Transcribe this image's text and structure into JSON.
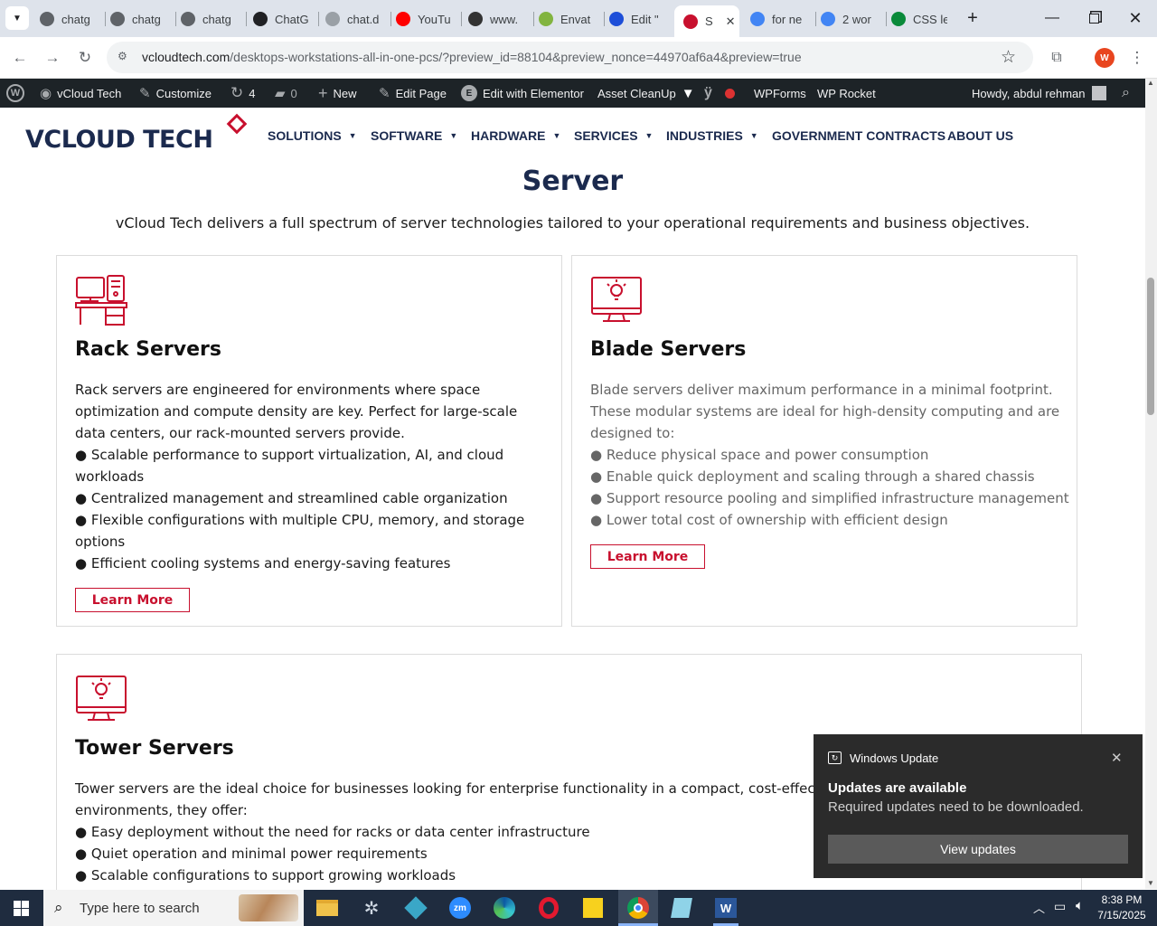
{
  "browser": {
    "tabs": [
      {
        "label": "chatg",
        "color": "#5f6368"
      },
      {
        "label": "chatg",
        "color": "#5f6368"
      },
      {
        "label": "chatg",
        "color": "#5f6368"
      },
      {
        "label": "ChatG",
        "color": "#202124"
      },
      {
        "label": "chat.d",
        "color": "#9aa0a6"
      },
      {
        "label": "YouTu",
        "color": "#ff0000"
      },
      {
        "label": "www.",
        "color": "#333333"
      },
      {
        "label": "Envat",
        "color": "#82b440"
      },
      {
        "label": "Edit \"",
        "color": "#1d4ed8"
      },
      {
        "label": "S",
        "color": "#c8102e",
        "active": true
      },
      {
        "label": "for ne",
        "color": "#4285f4"
      },
      {
        "label": "2 wor",
        "color": "#4285f4"
      },
      {
        "label": "CSS le",
        "color": "#0a8a3a"
      }
    ],
    "new_tab": "+",
    "close_tab": "✕",
    "url_host": "vcloudtech.com",
    "url_path": "/desktops-workstations-all-in-one-pcs/?preview_id=88104&preview_nonce=44970af6a4&preview=true",
    "profile_initial": "W"
  },
  "adminbar": {
    "site": "vCloud Tech",
    "customize": "Customize",
    "updates": "4",
    "comments": "0",
    "new": "New",
    "edit_page": "Edit Page",
    "elementor": "Edit with Elementor",
    "asset_cleanup": "Asset CleanUp",
    "wpforms": "WPForms",
    "wprocket": "WP Rocket",
    "howdy": "Howdy, abdul rehman"
  },
  "site": {
    "logo": "VCLOUD TECH",
    "menu": [
      "SOLUTIONS",
      "SOFTWARE",
      "HARDWARE",
      "SERVICES",
      "INDUSTRIES",
      "GOVERNMENT CONTRACTS",
      "ABOUT US"
    ],
    "menu_dropdowns": [
      true,
      true,
      true,
      true,
      true,
      false,
      false
    ]
  },
  "content": {
    "heading": "Server",
    "intro": "vCloud Tech delivers a full spectrum of server technologies tailored to your operational requirements and business objectives.",
    "cards": [
      {
        "title": "Rack Servers",
        "icon": "workstation-icon",
        "lines": [
          "Rack servers are engineered for environments where space",
          "optimization and compute density are key. Perfect for large-scale",
          "data centers, our rack-mounted servers provide.",
          "● Scalable performance to support virtualization, AI, and cloud",
          "workloads",
          "● Centralized management and streamlined cable organization",
          "● Flexible configurations with multiple CPU, memory, and storage",
          "options",
          "● Efficient cooling systems and energy-saving features"
        ],
        "button": "Learn More"
      },
      {
        "title": "Blade Servers",
        "icon": "monitor-bulb-icon",
        "lines": [
          "Blade servers deliver maximum performance in a minimal footprint.",
          "These modular systems are ideal for high-density computing and are",
          "designed to:",
          "● Reduce physical space and power consumption",
          "● Enable quick deployment and scaling through a shared chassis",
          "● Support resource pooling and simplified infrastructure management",
          "● Lower total cost of ownership with efficient design"
        ],
        "button": "Learn More"
      },
      {
        "title": "Tower Servers",
        "icon": "monitor-bulb-icon",
        "lines": [
          "Tower servers are the ideal choice for businesses looking for enterprise functionality in a compact, cost-effective",
          "environments, they offer:",
          "● Easy deployment without the need for racks or data center infrastructure",
          "● Quiet operation and minimal power requirements",
          "● Scalable configurations to support growing workloads"
        ]
      }
    ]
  },
  "toast": {
    "app": "Windows Update",
    "title": "Updates are available",
    "body": "Required updates need to be downloaded.",
    "button": "View updates"
  },
  "taskbar": {
    "search_placeholder": "Type here to search",
    "time": "8:38 PM",
    "date": "7/15/2025"
  },
  "colors": {
    "brand_navy": "#1b2a4e",
    "brand_red": "#c8102e",
    "adminbar": "#1d2327",
    "taskbar": "#1f2c3f"
  }
}
